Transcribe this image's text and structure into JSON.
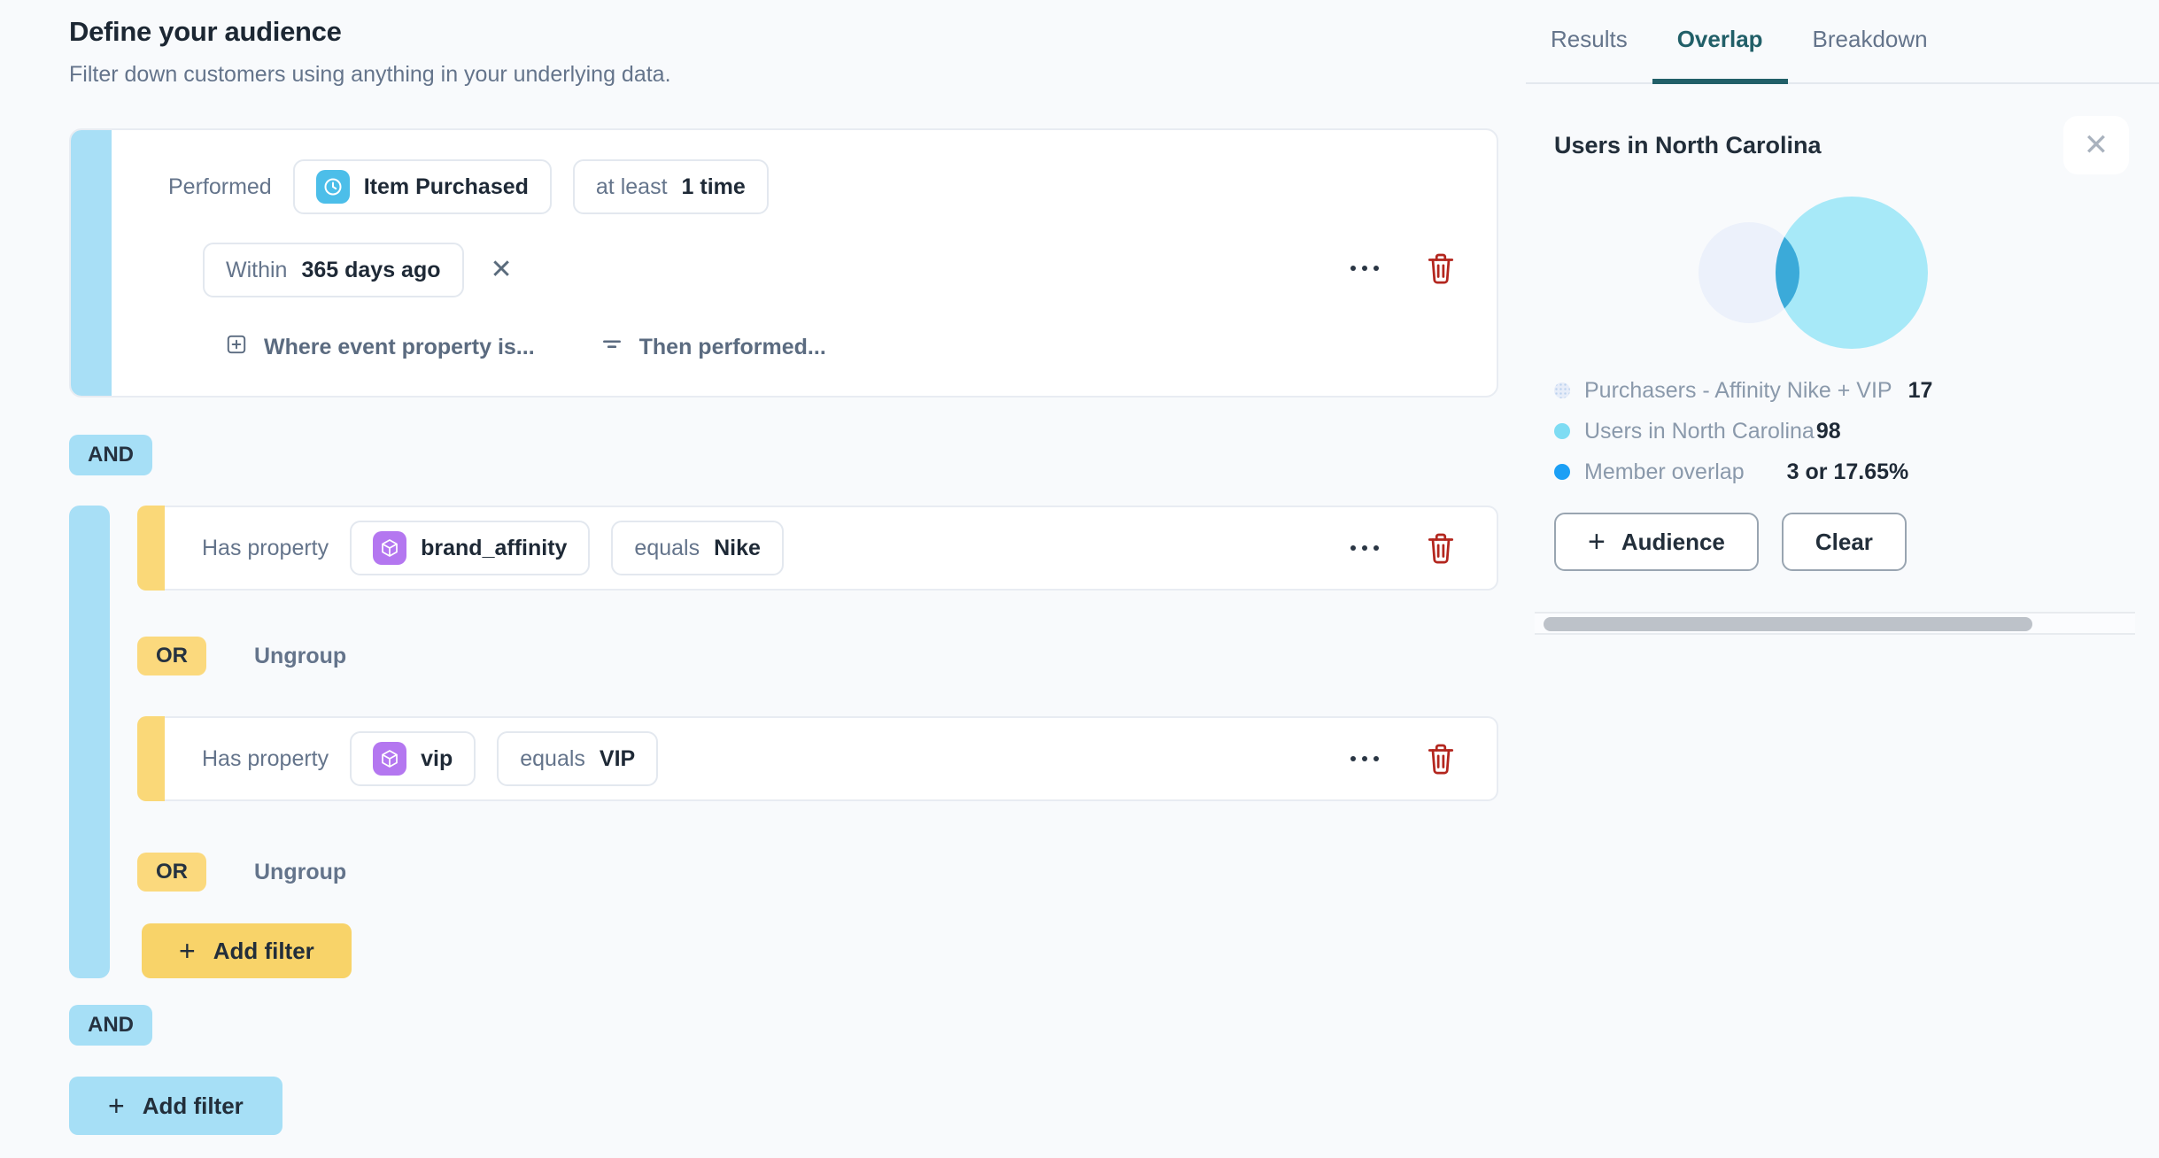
{
  "header": {
    "title": "Define your audience",
    "subtitle": "Filter down customers using anything in your underlying data."
  },
  "event_filter": {
    "prefix": "Performed",
    "event_name": "Item Purchased",
    "count_qualifier": "at least",
    "count_value": "1 time",
    "time_qualifier": "Within",
    "time_value": "365 days ago",
    "where_event_property_link": "Where event property is...",
    "then_performed_link": "Then performed..."
  },
  "connectors": {
    "and": "AND",
    "or": "OR",
    "ungroup": "Ungroup"
  },
  "property_filters": [
    {
      "prefix": "Has property",
      "name": "brand_affinity",
      "operator": "equals",
      "value": "Nike"
    },
    {
      "prefix": "Has property",
      "name": "vip",
      "operator": "equals",
      "value": "VIP"
    }
  ],
  "buttons": {
    "add_filter": "Add filter",
    "audience": "Audience",
    "clear": "Clear"
  },
  "icons": {
    "event": "clock-icon",
    "property": "cube-icon",
    "more": "ellipsis-icon",
    "delete": "trash-icon",
    "close": "x-icon"
  },
  "panel": {
    "tabs": [
      {
        "label": "Results"
      },
      {
        "label": "Overlap"
      },
      {
        "label": "Breakdown"
      }
    ],
    "active_tab": "Overlap",
    "title": "Users in North Carolina",
    "legend": [
      {
        "label": "Purchasers - Affinity Nike + VIP",
        "value": "17",
        "color": "#E7EDF9"
      },
      {
        "label": "Users in North Carolina",
        "value": "98",
        "color": "#7EDCF3"
      },
      {
        "label": "Member overlap",
        "value": "3 or 17.65%",
        "color": "#1B9FF5"
      }
    ]
  },
  "chart_data": {
    "type": "venn",
    "title": "Users in North Carolina",
    "sets": [
      {
        "label": "Purchasers - Affinity Nike + VIP",
        "size": 17,
        "color": "#ECF1FB"
      },
      {
        "label": "Users in North Carolina",
        "size": 98,
        "color": "#A7E9F8"
      }
    ],
    "overlap": {
      "label": "Member overlap",
      "size": 3,
      "percent": "17.65%",
      "color": "#3BAAD9"
    },
    "legend_position": "below"
  },
  "colors": {
    "accent_blue": "#A8DFF6",
    "accent_yellow": "#FAD878",
    "tab_active": "#215F68",
    "danger": "#B3261E",
    "event_icon_bg": "#4CBEE9",
    "property_icon_bg": "#B477F0"
  }
}
